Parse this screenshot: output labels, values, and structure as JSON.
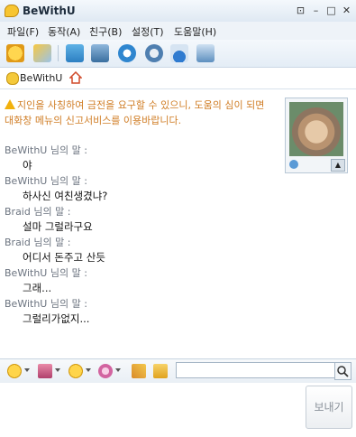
{
  "window": {
    "title": "BeWithU"
  },
  "menu": [
    "파일(F)",
    "동작(A)",
    "친구(B)",
    "설정(T)",
    "도움말(H)"
  ],
  "chat_header": {
    "buddy": "BeWithU"
  },
  "warning": "지인을 사칭하여 금전을 요구할 수 있으니, 도움의 심이 되면 대화창 메뉴의 신고서비스를 이용바랍니다.",
  "messages": [
    {
      "head": "BeWithU 님의 말 :",
      "body": "야"
    },
    {
      "head": "BeWithU 님의 말 :",
      "body": "하사신 여친생겼냐?"
    },
    {
      "head": "Braid 님의 말 :",
      "body": "설마 그럴라구요"
    },
    {
      "head": "Braid 님의 말 :",
      "body": "어디서 돈주고 산듯"
    },
    {
      "head": "BeWithU 님의 말 :",
      "body": "그래..."
    },
    {
      "head": "BeWithU 님의 말 :",
      "body": "그럴리가없지..."
    }
  ],
  "input": {
    "send_label": "보내기"
  },
  "colors": {
    "warning": "#d07d25",
    "titlebar": "#dfe9f3"
  }
}
